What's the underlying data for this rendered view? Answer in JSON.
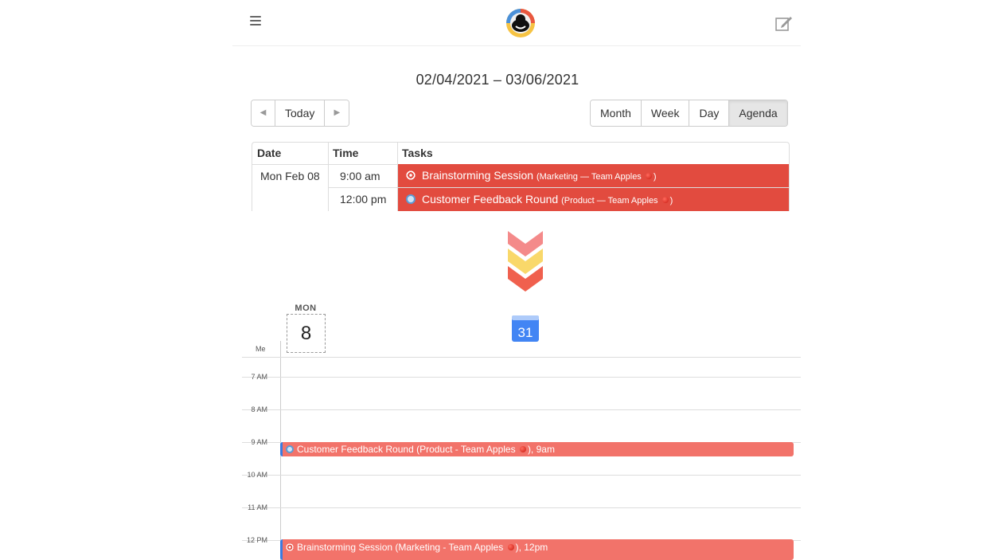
{
  "header": {
    "menu_icon": "hamburger-menu-icon",
    "logo_icon": "app-logo-icon",
    "compose_icon": "edit-compose-icon"
  },
  "agenda": {
    "range": "02/04/2021 – 03/06/2021",
    "nav": {
      "prev": "◀",
      "today": "Today",
      "next": "▶"
    },
    "views": [
      "Month",
      "Week",
      "Day",
      "Agenda"
    ],
    "active_view": "Agenda",
    "columns": {
      "date": "Date",
      "time": "Time",
      "tasks": "Tasks"
    },
    "date": "Mon Feb 08",
    "rows": [
      {
        "time": "9:00 am",
        "title": "Brainstorming Session",
        "detail_open": "(Marketing — Team Apples",
        "detail_close": ")",
        "icon": "target-icon"
      },
      {
        "time": "12:00 pm",
        "title": "Customer Feedback Round",
        "detail_open": "(Product — Team Apples",
        "detail_close": ")",
        "icon": "sync-icon"
      }
    ],
    "task_color": "#e24b3f"
  },
  "gcal": {
    "day_of_week": "MON",
    "day_number": "8",
    "icon_number": "31",
    "owner_label": "Me",
    "hours": [
      "7 AM",
      "8 AM",
      "9 AM",
      "10 AM",
      "11 AM",
      "12 PM"
    ],
    "events": [
      {
        "text_before": "Customer Feedback Round (Product - Team Apples",
        "text_after": "), 9am",
        "icon": "sync-icon"
      },
      {
        "text_before": "Brainstorming Session (Marketing - Team Apples",
        "text_after": "), 12pm",
        "icon": "target-icon"
      }
    ],
    "event_color": "#f2736a",
    "event_border_color": "#3b7be0"
  }
}
